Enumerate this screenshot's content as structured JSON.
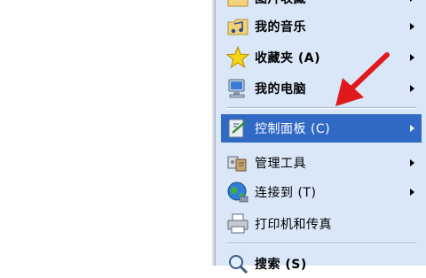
{
  "menu": {
    "items": [
      {
        "label": "图片收藏",
        "bold": true,
        "submenu": true
      },
      {
        "label": "我的音乐",
        "bold": true,
        "submenu": true
      },
      {
        "label": "收藏夹 (A)",
        "bold": true,
        "submenu": true
      },
      {
        "label": "我的电脑",
        "bold": true,
        "submenu": true
      },
      {
        "label": "控制面板 (C)",
        "bold": false,
        "submenu": true,
        "selected": true
      },
      {
        "label": "管理工具",
        "bold": false,
        "submenu": true
      },
      {
        "label": "连接到 (T)",
        "bold": false,
        "submenu": true
      },
      {
        "label": "打印机和传真",
        "bold": false,
        "submenu": false
      },
      {
        "label": "搜索 (S)",
        "bold": false,
        "submenu": false
      }
    ]
  },
  "colors": {
    "menu_background": "#d9e7f8",
    "selection_highlight": "#316ac5",
    "annotation_arrow": "#e0191c"
  },
  "icons": [
    "folder-pictures-icon",
    "folder-music-icon",
    "star-icon",
    "computer-icon",
    "control-panel-icon",
    "admin-tools-icon",
    "network-globe-icon",
    "printer-icon",
    "search-magnifier-icon"
  ]
}
